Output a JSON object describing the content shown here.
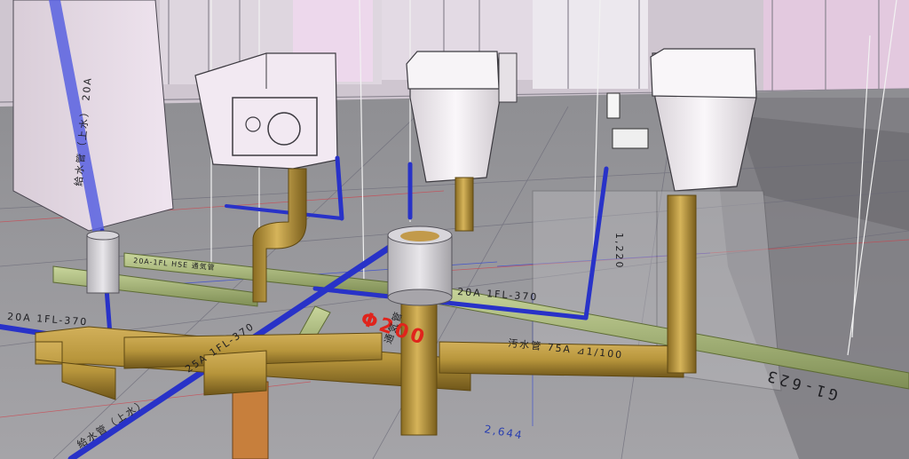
{
  "colors": {
    "drain_pipe": "#b8963c",
    "drain_pipe_dark": "#7d6220",
    "supply_pipe": "#2832c8",
    "vent_pipe": "#a8b879",
    "wall_tint": "#e9dce9",
    "fixture": "#f4f0f4"
  },
  "labels": {
    "supply_main_top": "給水管（上水） 20A",
    "supply_main_bottom": "給水管（上水）",
    "supply_branch_1": "20A 1FL-370",
    "supply_branch_2": "20A 1FL-370",
    "supply_25a": "25A 1FL-370",
    "drain_main": "汚水管 75A ⊿1/100",
    "drain_diameter": "Φ200",
    "grid_line": "G1-623",
    "height_mark": "1,220",
    "dimension": "2,644",
    "vent_label": "通気管",
    "vent_spec": "20A-1FL HSE 通気管"
  }
}
